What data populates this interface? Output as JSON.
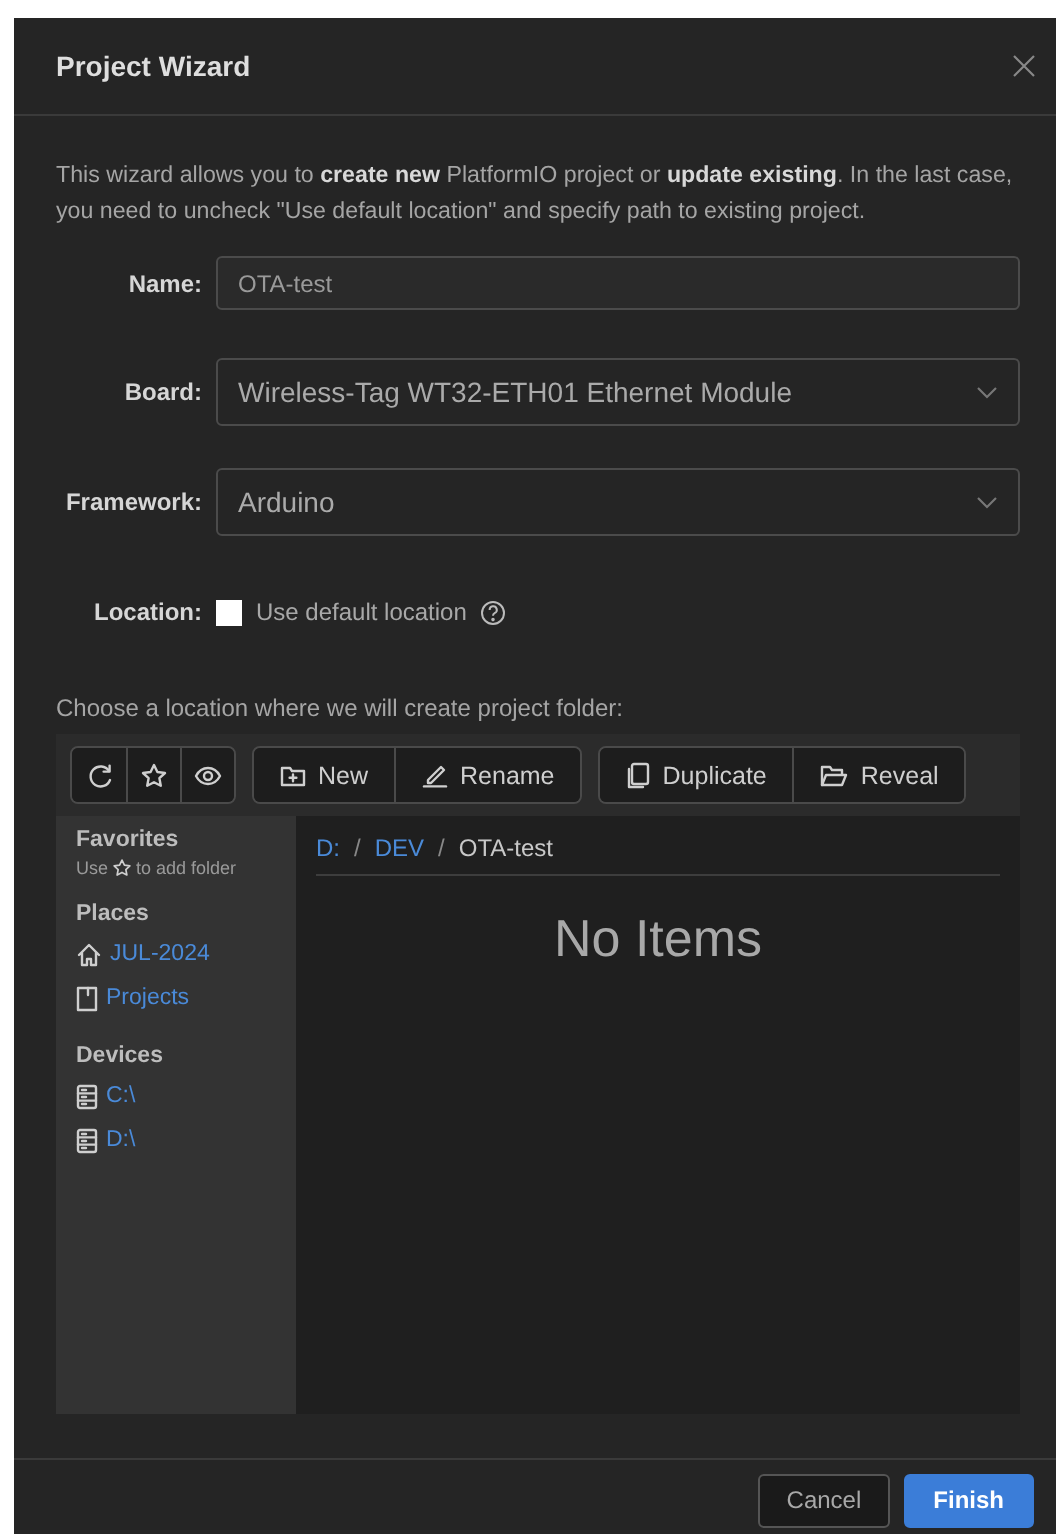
{
  "dialog": {
    "title": "Project Wizard",
    "description": "This wizard allows you to **create new** PlatformIO project or **update existing**. In the last case, you need to uncheck \"Use default location\" and specify path to existing project.",
    "fields": [
      {
        "kind": "text",
        "label": "Name:",
        "value": "OTA-test"
      },
      {
        "kind": "select",
        "label": "Board:",
        "value": "Wireless-Tag WT32-ETH01 Ethernet Module"
      },
      {
        "kind": "select",
        "label": "Framework:",
        "value": "Arduino"
      },
      {
        "kind": "checkbox",
        "label": "Location:",
        "text": "Use default location",
        "checked": false
      }
    ],
    "location_prompt": "Choose a location where we will create project folder:",
    "browser": {
      "labeled_groups": [
        [
          "New",
          "Rename"
        ],
        [
          "Duplicate",
          "Reveal"
        ]
      ],
      "sidebar": [
        {
          "kind": "favorites",
          "title": "Favorites",
          "hint_before": "Use",
          "hint_after": "to add folder"
        },
        {
          "kind": "places",
          "title": "Places",
          "items": [
            "JUL-2024",
            "Projects"
          ]
        },
        {
          "kind": "devices",
          "title": "Devices",
          "items": [
            "C:\\",
            "D:\\"
          ]
        }
      ],
      "breadcrumb": [
        {
          "kind": "link",
          "text": "D:"
        },
        {
          "kind": "separator",
          "text": "/"
        },
        {
          "kind": "link",
          "text": "DEV"
        },
        {
          "kind": "separator",
          "text": "/"
        },
        {
          "kind": "current",
          "text": "OTA-test"
        }
      ],
      "empty_message": "No Items"
    },
    "buttons": [
      {
        "label": "Cancel",
        "primary": false
      },
      {
        "label": "Finish",
        "primary": true
      }
    ]
  }
}
